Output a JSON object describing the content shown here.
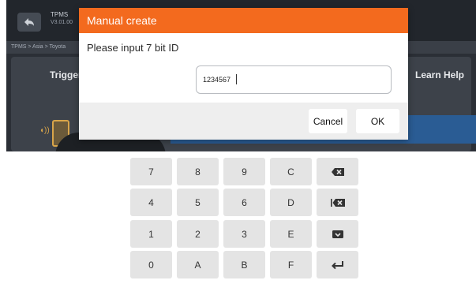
{
  "app": {
    "title": "TPMS",
    "version": "V3.01.00",
    "breadcrumb": "TPMS > Asia > Toyota",
    "tabs": {
      "trigger": "Trigger",
      "learn_help": "Learn Help"
    }
  },
  "dialog": {
    "title": "Manual create",
    "prompt": "Please input 7 bit ID",
    "input_value": "1234567",
    "cancel_label": "Cancel",
    "ok_label": "OK",
    "header_color": "#f36a1e"
  },
  "keypad": {
    "rows": [
      [
        "7",
        "8",
        "9",
        "C"
      ],
      [
        "4",
        "5",
        "6",
        "D"
      ],
      [
        "1",
        "2",
        "3",
        "E"
      ],
      [
        "0",
        "A",
        "B",
        "F"
      ]
    ],
    "action_keys": [
      "backspace-icon",
      "clear-all-icon",
      "hide-keyboard-icon",
      "enter-icon"
    ]
  }
}
